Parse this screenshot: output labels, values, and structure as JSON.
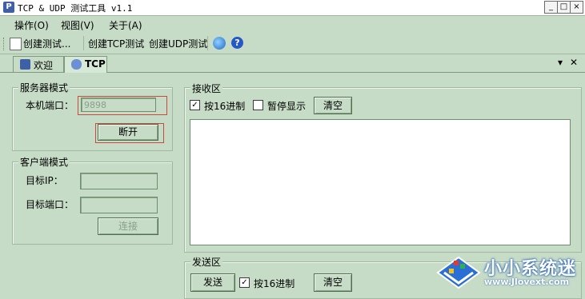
{
  "window": {
    "title": "TCP & UDP 测试工具 v1.1",
    "minimize": "_",
    "maximize": "□",
    "close": "×"
  },
  "menu": [
    "操作(O)",
    "视图(V)",
    "关于(A)"
  ],
  "toolbar": {
    "create_test": "创建测试...",
    "create_tcp": "创建TCP测试",
    "create_udp": "创建UDP测试"
  },
  "tabs": [
    {
      "label": "欢迎"
    },
    {
      "label": "TCP"
    }
  ],
  "tab_controls": {
    "dropdown": "▾",
    "close": "✕"
  },
  "server_mode": {
    "legend": "服务器模式",
    "port_label": "本机端口：",
    "port_value": "9898",
    "disconnect": "断开"
  },
  "client_mode": {
    "legend": "客户端模式",
    "target_ip_label": "目标IP：",
    "target_port_label": "目标端口：",
    "connect": "连接"
  },
  "receive": {
    "legend": "接收区",
    "hex_label": "按16进制",
    "hex_checked": true,
    "pause_label": "暂停显示",
    "pause_checked": false,
    "clear": "清空"
  },
  "send": {
    "legend": "发送区",
    "send_button": "发送",
    "hex_label": "按16进制",
    "hex_checked": true,
    "clear": "清空"
  },
  "watermark": {
    "name": "小小系统迷",
    "url": "www.Jlovext.com"
  }
}
